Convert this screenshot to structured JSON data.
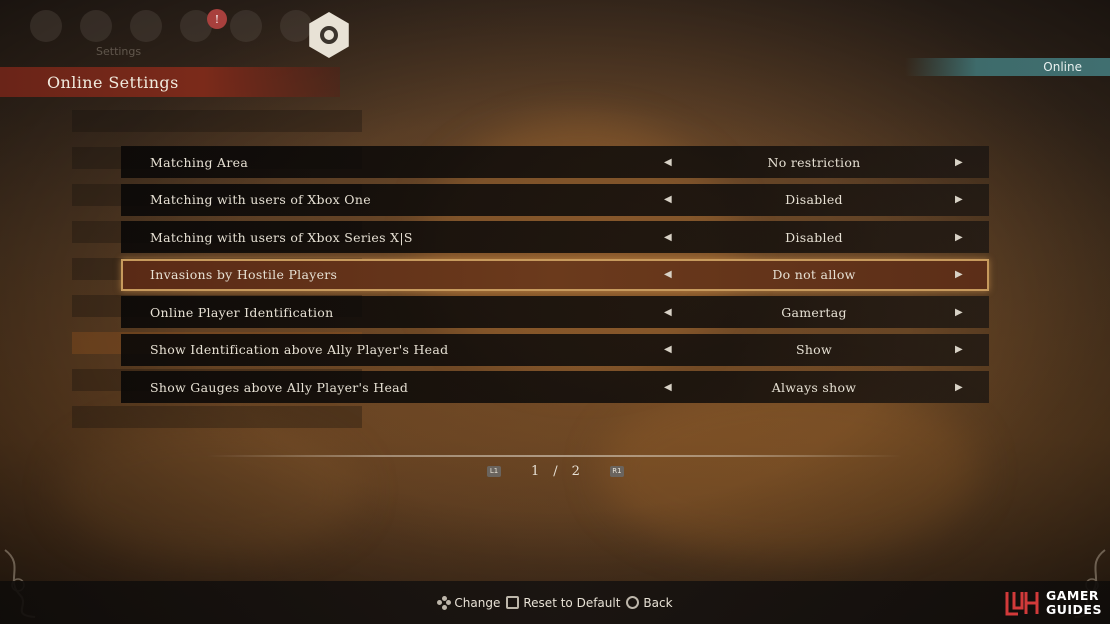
{
  "header": {
    "title": "Online Settings",
    "mode_tag": "Online",
    "faded_sub_label": "Settings",
    "badge_count": "!"
  },
  "settings": [
    {
      "label": "Matching Area",
      "value": "No restriction"
    },
    {
      "label": "Matching with users of Xbox One",
      "value": "Disabled"
    },
    {
      "label": "Matching with users of Xbox Series X|S",
      "value": "Disabled"
    },
    {
      "label": "Invasions by Hostile Players",
      "value": "Do not allow",
      "selected": true
    },
    {
      "label": "Online Player Identification",
      "value": "Gamertag"
    },
    {
      "label": "Show Identification above Ally Player's Head",
      "value": "Show"
    },
    {
      "label": "Show Gauges above Ally Player's Head",
      "value": "Always show"
    }
  ],
  "pagination": {
    "prev_button": "L1",
    "current": "1",
    "separator": "/",
    "total": "2",
    "next_button": "R1"
  },
  "footer": {
    "change": "Change",
    "reset": "Reset to Default",
    "back": "Back"
  },
  "branding": {
    "line1": "GAMER",
    "line2": "GUIDES"
  },
  "colors": {
    "accent_red": "#7b2a1a",
    "selected_border": "#c79a5d",
    "online_tag": "#406f70"
  },
  "icons": [
    "arrow-left-icon",
    "arrow-right-icon",
    "dpad-icon",
    "square-button-icon",
    "circle-button-icon",
    "gear-icon"
  ]
}
